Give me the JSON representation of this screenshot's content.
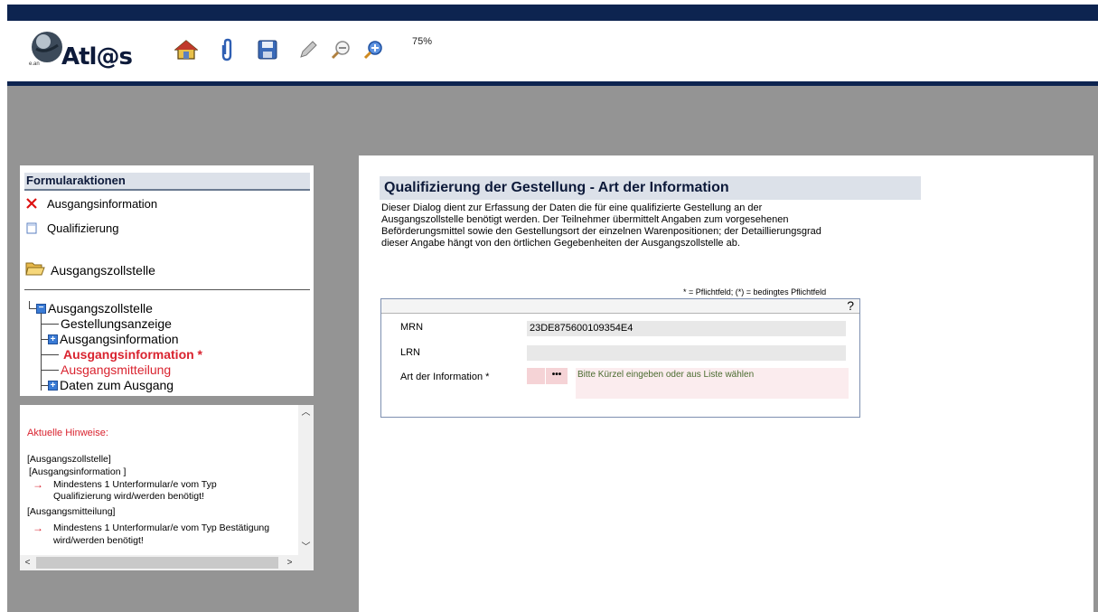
{
  "header": {
    "logo_text": "Atl@s",
    "logo_small": "e.an",
    "zoom": "75%",
    "toolbar": [
      "home-icon",
      "attach-icon",
      "save-icon",
      "edit-icon",
      "zoom-out-icon",
      "zoom-in-icon"
    ]
  },
  "formularaktionen": {
    "title": "Formularaktionen",
    "items": [
      {
        "label": "Ausgangsinformation",
        "icon": "delete-x-icon"
      },
      {
        "label": "Qualifizierung",
        "icon": "document-icon"
      }
    ],
    "folder_label": "Ausgangszollstelle"
  },
  "tree": {
    "root": "Ausgangszollstelle",
    "items": [
      {
        "label": "Gestellungsanzeige"
      },
      {
        "label": "Ausgangsinformation"
      },
      {
        "label": "Ausgangsinformation *"
      },
      {
        "label": "Ausgangsmitteilung"
      },
      {
        "label": "Daten zum Ausgang"
      }
    ]
  },
  "hints": {
    "title": "Aktuelle Hinweise:",
    "lines": [
      "[Ausgangszollstelle]",
      "[Ausgangsinformation ]",
      "Mindestens 1 Unterformular/e vom Typ",
      "Qualifizierung wird/werden benötigt!",
      "[Ausgangsmitteilung]",
      "Mindestens 1 Unterformular/e vom Typ Bestätigung",
      "wird/werden benötigt!"
    ]
  },
  "main": {
    "title": "Qualifizierung der Gestellung - Art der Information",
    "desc_lines": [
      "Dieser Dialog dient zur Erfassung der Daten die für eine qualifizierte Gestellung an der",
      "Ausgangszollstelle benötigt werden. Der Teilnehmer übermittelt Angaben zum vorgesehenen",
      "Beförderungsmittel sowie den Gestellungsort der einzelnen Warenpositionen; der Detaillierungsgrad",
      "dieser Angabe hängt von den örtlichen Gegebenheiten der Ausgangszollstelle ab."
    ],
    "legend": "* = Pflichtfeld; (*) = bedingtes Pflichtfeld",
    "help": "?",
    "fields": {
      "mrn_label": "MRN",
      "mrn_value": "23DE875600109354E4",
      "lrn_label": "LRN",
      "lrn_value": "",
      "art_label": "Art der Information *",
      "art_dots": "•••",
      "art_hint": "Bitte Kürzel eingeben oder aus Liste wählen"
    }
  }
}
